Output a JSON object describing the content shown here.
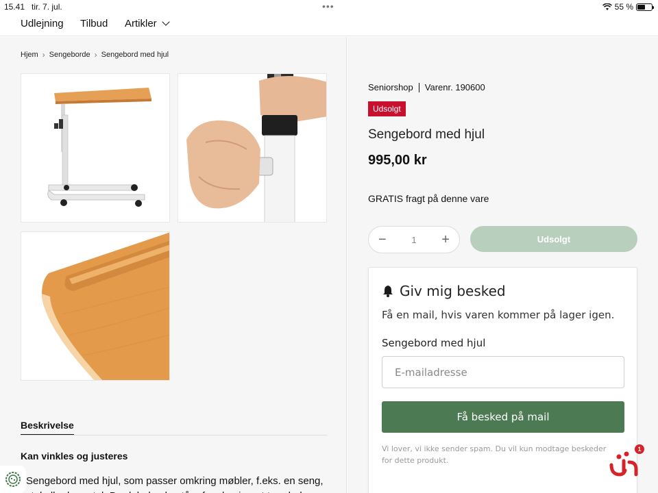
{
  "status_bar": {
    "time": "15.41",
    "date": "tir. 7. jul.",
    "battery_text": "55 %",
    "battery_level": 0.55
  },
  "nav": {
    "items": [
      "Udlejning",
      "Tilbud",
      "Artikler"
    ]
  },
  "breadcrumb": [
    "Hjem",
    "Sengeborde",
    "Sengebord med hjul"
  ],
  "product": {
    "shop": "Seniorshop",
    "sku_label": "Varenr. 190600",
    "badge": "Udsolgt",
    "title": "Sengebord med hjul",
    "price": "995,00 kr",
    "shipping": "GRATIS fragt på denne vare",
    "quantity": "1",
    "soldout_button": "Udsolgt"
  },
  "notify": {
    "title": "Giv mig besked",
    "subtitle": "Få en mail, hvis varen kommer på lager igen.",
    "product_name": "Sengebord med hjul",
    "email_placeholder": "E-mailadresse",
    "button": "Få besked på mail",
    "disclaimer": "Vi lover, vi ikke sender spam. Du vil kun modtage beskeder for dette produkt."
  },
  "description": {
    "tab": "Beskrivelse",
    "heading": "Kan vinkles og justeres",
    "text": "Sengebord med hjul, som passer omkring møbler, f.eks. en seng, stol eller kørestol. Bordpladen består af en lamineret træplade"
  },
  "chat": {
    "badge_count": "1"
  },
  "colors": {
    "sold_out_badge": "#c8102e",
    "notify_button": "#4c7a52",
    "disabled_button": "#b9cfbe",
    "chat_icon": "#d6232a"
  }
}
